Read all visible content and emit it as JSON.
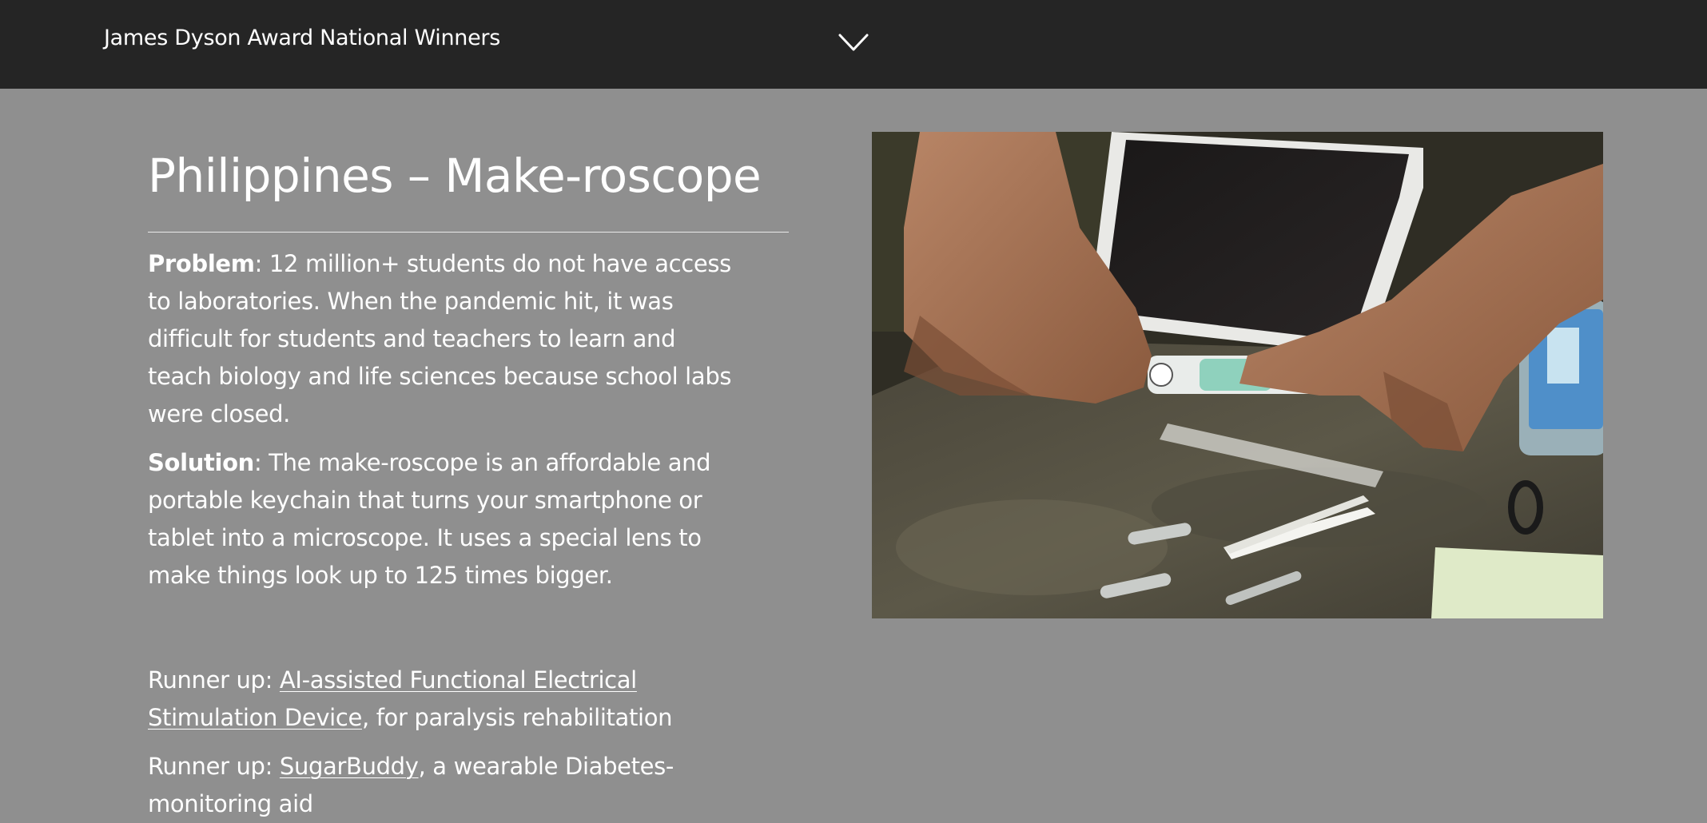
{
  "header": {
    "title": "James Dyson Award National Winners",
    "toggle_icon": "chevron-down-icon"
  },
  "main": {
    "heading": "Philippines – Make-roscope",
    "problem": {
      "label": "Problem",
      "text": ": 12 million+ students do not have access to laboratories. When the pandemic hit, it was difficult for students and teachers to learn and teach biology and life sciences because school labs were closed."
    },
    "solution": {
      "label": "Solution",
      "text": ": The make-roscope is an affordable and portable keychain that turns your smartphone or tablet into a microscope. It uses a special lens to make things look up to 125 times bigger."
    },
    "runners_up": [
      {
        "prefix": "Runner up: ",
        "link_text": "AI-assisted Functional Electrical Stimulation Device",
        "suffix": ", for paralysis rehabilitation"
      },
      {
        "prefix": "Runner up: ",
        "link_text": "SugarBuddy",
        "suffix": ", a wearable Diabetes-monitoring aid"
      }
    ]
  },
  "colors": {
    "page_background": "#8f8f8f",
    "header_background": "#252525",
    "text": "#ffffff"
  }
}
